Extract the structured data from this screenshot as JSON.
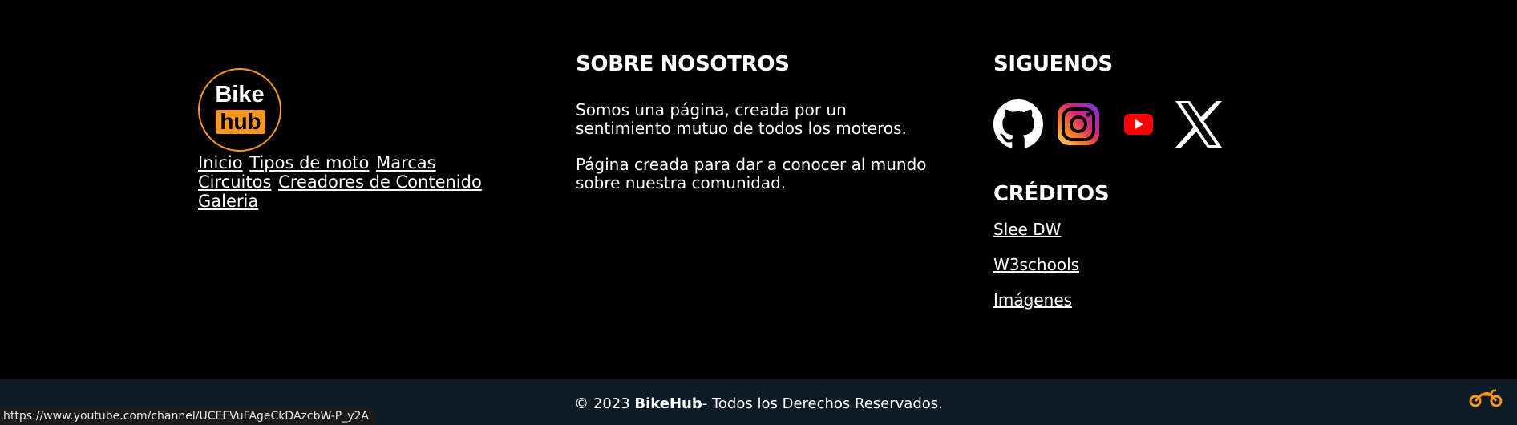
{
  "logo": {
    "top": "Bike",
    "bottom": "hub"
  },
  "nav": {
    "links": [
      "Inicio",
      "Tipos de moto",
      "Marcas",
      "Circuitos",
      "Creadores de Contenido",
      "Galeria"
    ]
  },
  "about": {
    "title": "SOBRE NOSOTROS",
    "p1": "Somos una página, creada por un sentimiento mutuo de todos los moteros.",
    "p2": "Página creada para dar a conocer al mundo sobre nuestra comunidad."
  },
  "social": {
    "title": "SIGUENOS",
    "icons": [
      "github-icon",
      "instagram-icon",
      "youtube-icon",
      "x-icon"
    ]
  },
  "credits": {
    "title": "CRÉDITOS",
    "links": [
      "Slee DW",
      "W3schools",
      "Imágenes"
    ]
  },
  "footer_bottom": {
    "prefix": "© 2023 ",
    "brand": "BikeHub",
    "suffix": "- Todos los Derechos Reservados."
  },
  "status_bar": {
    "url": "https://www.youtube.com/channel/UCEEVuFAgeCkDAzcbW-P_y2A"
  },
  "colors": {
    "accent": "#f7971e",
    "background": "#000000",
    "bottom_bar": "#0e1a25",
    "youtube_red": "#ff0000"
  }
}
